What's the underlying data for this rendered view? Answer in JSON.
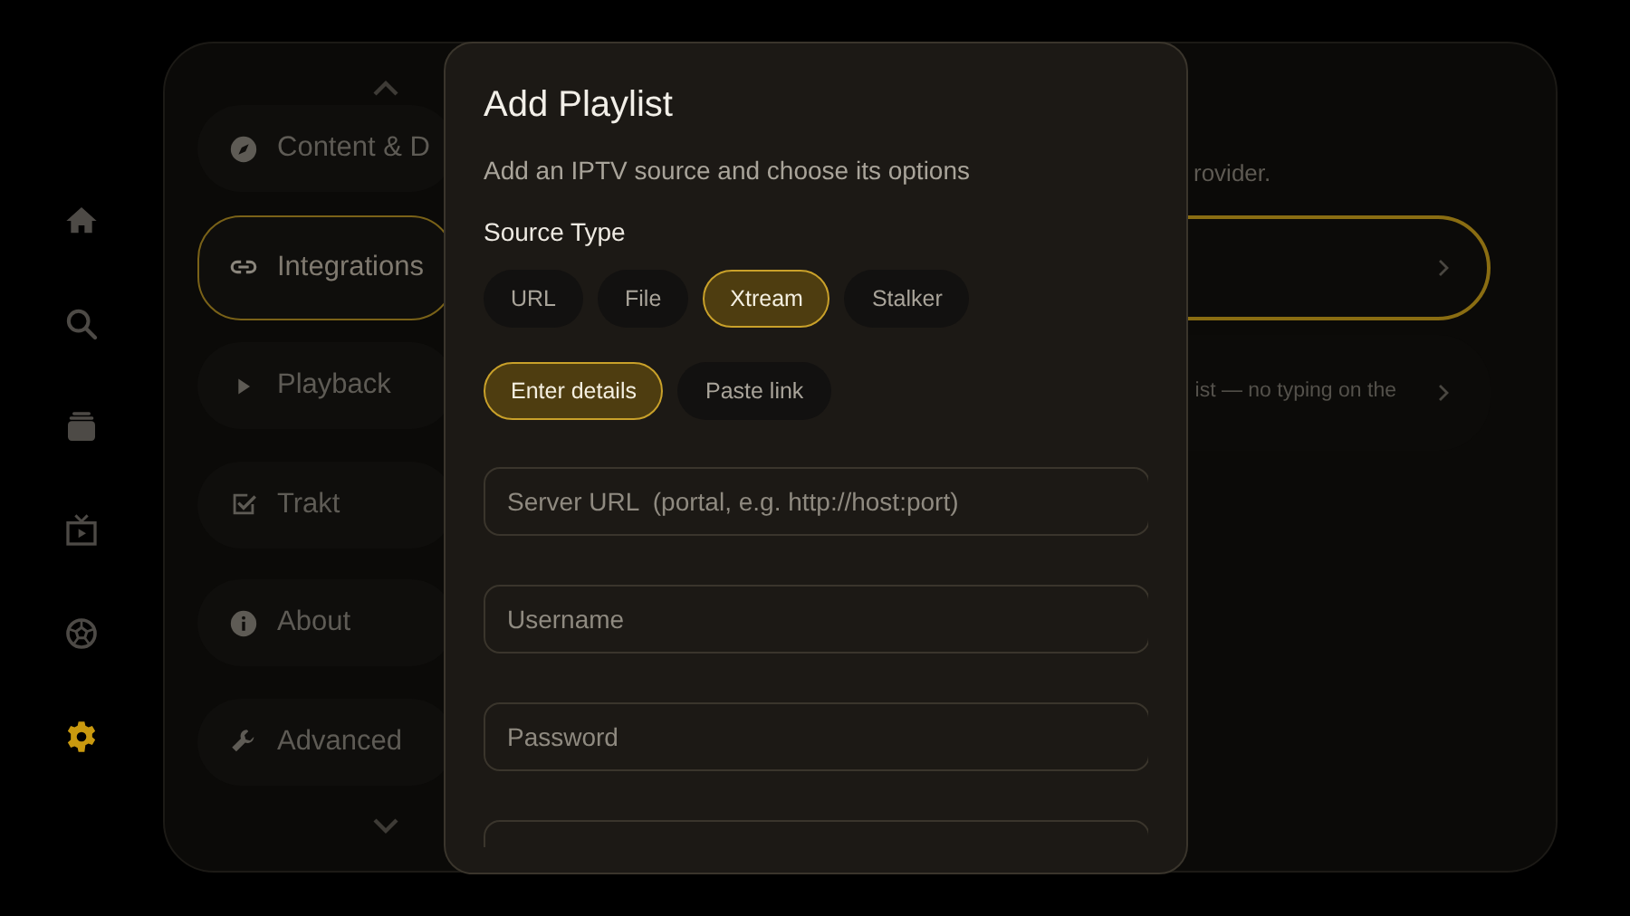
{
  "nav_rail": [
    {
      "kind": "home",
      "selected": false
    },
    {
      "kind": "search",
      "selected": false
    },
    {
      "kind": "library",
      "selected": false
    },
    {
      "kind": "tv",
      "selected": false
    },
    {
      "kind": "sports",
      "selected": false
    },
    {
      "kind": "settings",
      "selected": true
    }
  ],
  "settings_menu": [
    {
      "kind": "compass",
      "label": "Content & D",
      "selected": false
    },
    {
      "kind": "link",
      "label": "Integrations",
      "selected": true
    },
    {
      "kind": "play",
      "label": "Playback",
      "selected": false
    },
    {
      "kind": "check",
      "label": "Trakt",
      "selected": false
    },
    {
      "kind": "info",
      "label": "About",
      "selected": false
    },
    {
      "kind": "wrench",
      "label": "Advanced",
      "selected": false
    }
  ],
  "content": {
    "description": "rovider.",
    "options": [
      {
        "selected": true
      },
      {
        "description": "ist — no typing on the",
        "selected": false
      }
    ]
  },
  "dialog": {
    "title": "Add Playlist",
    "subtitle": "Add an IPTV source and choose its options",
    "source_type_label": "Source Type",
    "source_types": [
      {
        "label": "URL",
        "selected": false
      },
      {
        "label": "File",
        "selected": false
      },
      {
        "label": "Xtream",
        "selected": true
      },
      {
        "label": "Stalker",
        "selected": false
      }
    ],
    "input_modes": [
      {
        "label": "Enter details",
        "selected": true
      },
      {
        "label": "Paste link",
        "selected": false
      }
    ],
    "fields": [
      {
        "placeholder": "Server URL  (portal, e.g. http://host:port)"
      },
      {
        "placeholder": "Username"
      },
      {
        "placeholder": "Password"
      }
    ]
  }
}
